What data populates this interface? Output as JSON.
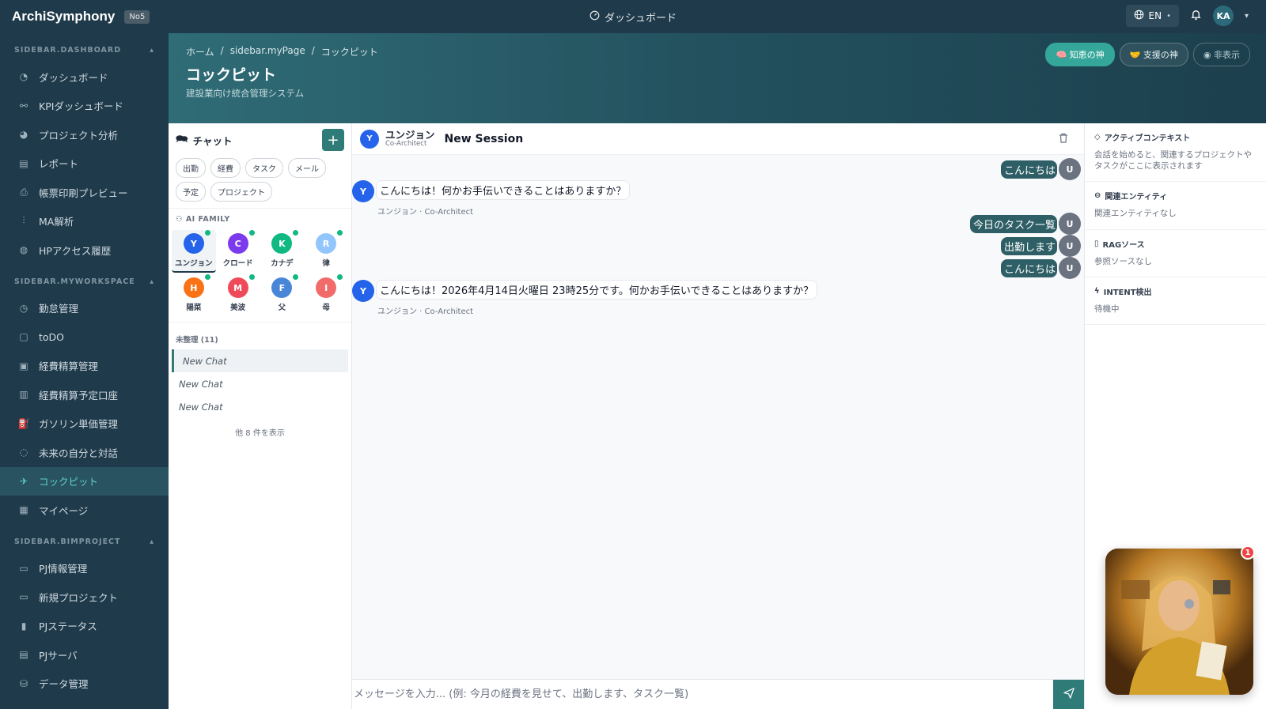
{
  "topbar": {
    "brand": "ArchiSymphony",
    "badge": "No5",
    "center_label": "ダッシュボード",
    "lang": "EN",
    "user_initials": "KA"
  },
  "sidebar": {
    "sections": [
      {
        "title": "SIDEBAR.DASHBOARD",
        "items": [
          {
            "label": "ダッシュボード",
            "icon": "dashboard-icon"
          },
          {
            "label": "KPIダッシュボード",
            "icon": "kpi-icon"
          },
          {
            "label": "プロジェクト分析",
            "icon": "pie-chart-icon"
          },
          {
            "label": "レポート",
            "icon": "report-icon"
          },
          {
            "label": "帳票印刷プレビュー",
            "icon": "printer-icon"
          },
          {
            "label": "MA解析",
            "icon": "analytics-icon"
          },
          {
            "label": "HPアクセス履歴",
            "icon": "globe-icon"
          }
        ]
      },
      {
        "title": "SIDEBAR.MYWORKSPACE",
        "items": [
          {
            "label": "勤怠管理",
            "icon": "clock-icon"
          },
          {
            "label": "toDO",
            "icon": "todo-icon"
          },
          {
            "label": "経費精算管理",
            "icon": "expense-icon"
          },
          {
            "label": "経費精算予定口座",
            "icon": "bank-icon"
          },
          {
            "label": "ガソリン単価管理",
            "icon": "fuel-icon"
          },
          {
            "label": "未来の自分と対話",
            "icon": "chat-bubble-icon"
          },
          {
            "label": "コックピット",
            "icon": "rocket-icon",
            "active": true
          },
          {
            "label": "マイページ",
            "icon": "grid-icon"
          }
        ]
      },
      {
        "title": "SIDEBAR.BIMPROJECT",
        "items": [
          {
            "label": "PJ情報管理",
            "icon": "folder-icon"
          },
          {
            "label": "新規プロジェクト",
            "icon": "folder-plus-icon"
          },
          {
            "label": "PJステータス",
            "icon": "bar-chart-icon"
          },
          {
            "label": "PJサーバ",
            "icon": "server-icon"
          },
          {
            "label": "データ管理",
            "icon": "database-icon"
          }
        ]
      }
    ]
  },
  "banner": {
    "breadcrumb": [
      "ホーム",
      "/",
      "sidebar.myPage",
      "/",
      "コックピット"
    ],
    "title": "コックピット",
    "subtitle": "建設業向け統合管理システム",
    "buttons": [
      "知恵の神",
      "支援の神",
      "非表示"
    ]
  },
  "chatlist": {
    "title": "チャット",
    "chips": [
      "出勤",
      "経費",
      "タスク",
      "メール",
      "予定",
      "プロジェクト"
    ],
    "ai_family_label": "AI FAMILY",
    "agents": [
      {
        "initial": "Y",
        "name": "ユンジョン",
        "color": "#2563eb",
        "selected": true,
        "online": true
      },
      {
        "initial": "C",
        "name": "クロード",
        "color": "#7c3aed",
        "online": true
      },
      {
        "initial": "K",
        "name": "カナデ",
        "color": "#10b981",
        "online": true
      },
      {
        "initial": "R",
        "name": "律",
        "color": "#93c5fd",
        "online": true
      },
      {
        "initial": "H",
        "name": "陽菜",
        "color": "#f97316",
        "online": true
      },
      {
        "initial": "M",
        "name": "美波",
        "color": "#ef4a5a",
        "online": true
      },
      {
        "initial": "F",
        "name": "父",
        "color": "#4a86d8",
        "online": true
      },
      {
        "initial": "I",
        "name": "母",
        "color": "#f26b6b",
        "online": true
      }
    ],
    "group_label": "未整理 (11)",
    "chats": [
      "New Chat",
      "New Chat",
      "New Chat"
    ],
    "more_label": "他 8 件を表示"
  },
  "chat": {
    "agent_initial": "Y",
    "agent_name": "ユンジョン",
    "agent_role": "Co-Architect",
    "session_title": "New Session",
    "user_initial": "U",
    "messages": [
      {
        "from": "user",
        "text": "こんにちは"
      },
      {
        "from": "ai",
        "text": "こんにちは！何かお手伝いできることはありますか？",
        "meta": "ユンジョン · Co-Architect"
      },
      {
        "from": "user",
        "text": "今日のタスク一覧"
      },
      {
        "from": "user",
        "text": "出勤します"
      },
      {
        "from": "user",
        "text": "こんにちは"
      },
      {
        "from": "ai",
        "text": "こんにちは！2026年4月14日火曜日 23時25分です。何かお手伝いできることはありますか？",
        "meta": "ユンジョン · Co-Architect"
      }
    ],
    "input_placeholder": "メッセージを入力... (例: 今月の経費を見せて、出勤します、タスク一覧)"
  },
  "context": {
    "sections": [
      {
        "title": "アクティブコンテキスト",
        "body": "会話を始めると、関連するプロジェクトやタスクがここに表示されます"
      },
      {
        "title": "関連エンティティ",
        "body": "関連エンティティなし"
      },
      {
        "title": "RAGソース",
        "body": "参照ソースなし"
      },
      {
        "title": "INTENT検出",
        "body": "待機中"
      }
    ]
  },
  "floating": {
    "badge_count": "1"
  },
  "colors": {
    "sidebar_bg": "#1f3a4a",
    "accent": "#2f7b78",
    "active_text": "#5fd4c2"
  }
}
